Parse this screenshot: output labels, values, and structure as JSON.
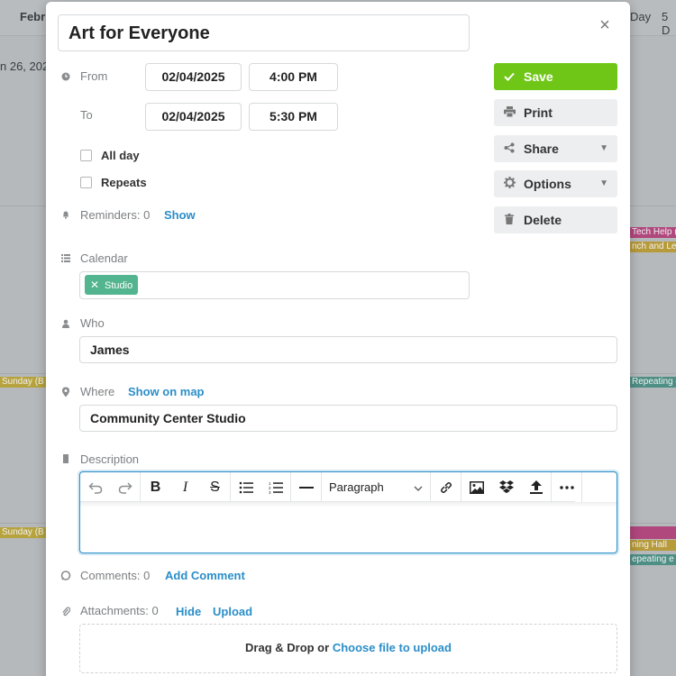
{
  "background": {
    "month_label": "Febr",
    "date_label": "n 26, 202",
    "view_day": "Day",
    "view_5day": "5 D",
    "events": [
      "Sunday (B",
      "Tech Help (",
      "nch and Le",
      "Repeating e",
      "Sunday (B",
      "ning Hall",
      "epeating e"
    ]
  },
  "event": {
    "title": "Art for Everyone",
    "from_label": "From",
    "from_date": "02/04/2025",
    "from_time": "4:00 PM",
    "to_label": "To",
    "to_date": "02/04/2025",
    "to_time": "5:30 PM",
    "all_day_label": "All day",
    "repeats_label": "Repeats",
    "reminders_label": "Reminders: 0",
    "reminders_show": "Show",
    "calendar_label": "Calendar",
    "calendar_tag": "Studio",
    "who_label": "Who",
    "who_value": "James",
    "where_label": "Where",
    "where_map_link": "Show on map",
    "where_value": "Community Center Studio",
    "description_label": "Description",
    "paragraph_select": "Paragraph",
    "comments_label": "Comments: 0",
    "add_comment": "Add Comment",
    "attachments_label": "Attachments: 0",
    "hide_link": "Hide",
    "upload_link": "Upload",
    "dropzone_text": "Drag & Drop or ",
    "dropzone_link": "Choose file to upload"
  },
  "actions": {
    "save": "Save",
    "print": "Print",
    "share": "Share",
    "options": "Options",
    "delete": "Delete"
  },
  "colors": {
    "save_green": "#6fc617",
    "link_blue": "#2b8ec8",
    "tag_green": "#53b58f"
  }
}
